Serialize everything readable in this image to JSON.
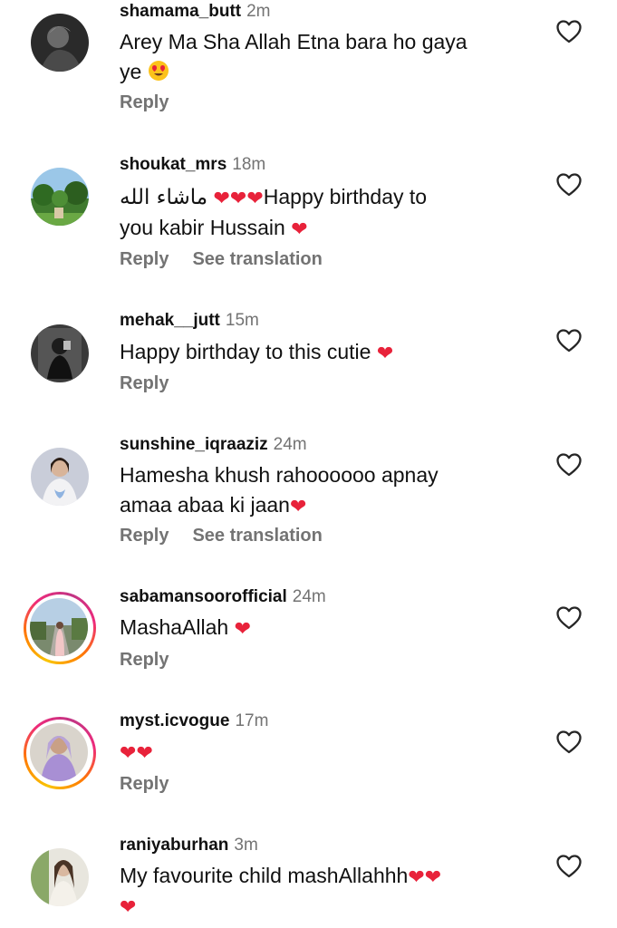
{
  "comments": [
    {
      "username": "shamama_butt",
      "time": "2m",
      "text_line1": "Arey Ma Sha Allah Etna bara ho gaya",
      "text_line2": "ye",
      "reply": "Reply"
    },
    {
      "username": "shoukat_mrs",
      "time": "18m",
      "arabic": "ماشاء الله",
      "text_line1": "Happy birthday to",
      "text_line2": "you kabir Hussain",
      "reply": "Reply",
      "translate": "See translation"
    },
    {
      "username": "mehak__jutt",
      "time": "15m",
      "text_line1": "Happy birthday to this cutie",
      "reply": "Reply"
    },
    {
      "username": "sunshine_iqraaziz",
      "time": "24m",
      "text_line1": "Hamesha khush rahoooooo apnay",
      "text_line2": "amaa abaa ki jaan",
      "reply": "Reply",
      "translate": "See translation"
    },
    {
      "username": "sabamansoorofficial",
      "time": "24m",
      "text_line1": "MashaAllah",
      "reply": "Reply"
    },
    {
      "username": "myst.icvogue",
      "time": "17m",
      "reply": "Reply"
    },
    {
      "username": "raniyaburhan",
      "time": "3m",
      "text_line1": "My favourite child mashAllahhh"
    }
  ],
  "icons": {
    "heart_emoji": "❤",
    "like": "heart-outline-icon"
  },
  "colors": {
    "heart": "#e8223a",
    "muted": "#737373",
    "text": "#111111"
  }
}
